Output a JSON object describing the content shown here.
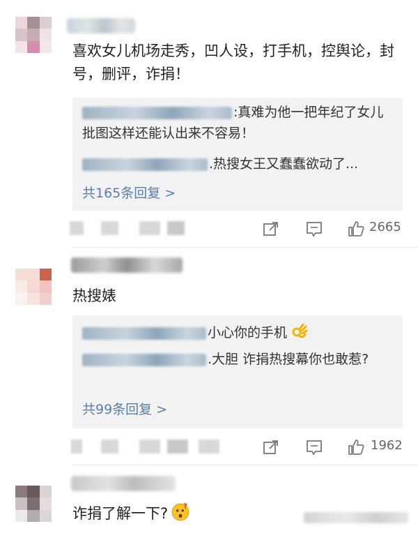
{
  "comments": [
    {
      "text": "喜欢女儿机场走秀，凹人设，打手机，控舆论，封号，删评，诈捐！",
      "replies": [
        {
          "text": ":真难为他一把年纪了女儿批图这样还能认出来不容易！"
        },
        {
          "text": ".热搜女王又蠢蠢欲动了..."
        }
      ],
      "reply_count_label": "共165条回复 >",
      "like_count": "2665",
      "avatar_colors": [
        "#e9d9dd",
        "#a99095",
        "#d9cfd0",
        "#d8c4c8",
        "#c7adb4",
        "#efe3e6",
        "#f3e4ea",
        "#d48fae",
        "#f0e8ea"
      ]
    },
    {
      "text": "热搜婊",
      "replies": [
        {
          "text": "小心你的手机",
          "emoji": "ok-hand-emoji"
        },
        {
          "text": ".大胆 诈捐热搜幕你也敢惹?"
        }
      ],
      "reply_count_label": "共99条回复 >",
      "like_count": "1962",
      "avatar_colors": [
        "#f4ded8",
        "#f5ddd5",
        "#c86450",
        "#f9ece8",
        "#f6d9d3",
        "#f4c2bf",
        "#fbf1ee",
        "#f7e3e0",
        "#f2cfcf"
      ]
    },
    {
      "text": "诈捐了解一下?",
      "emoji": "thinking-face-emoji",
      "avatar_colors": [
        "#8a7b7c",
        "#6b5a5c",
        "#d9d3d3",
        "#c9c1c2",
        "#7d6f71",
        "#e3dede",
        "#efeaea",
        "#b5abac",
        "#dcd6d6"
      ]
    }
  ],
  "icons": {
    "share": "share-icon",
    "comment": "comment-icon",
    "like": "thumbs-up-icon"
  },
  "colors": {
    "reply_link": "#5b7ea8",
    "reply_bg": "#f2f2f2"
  }
}
